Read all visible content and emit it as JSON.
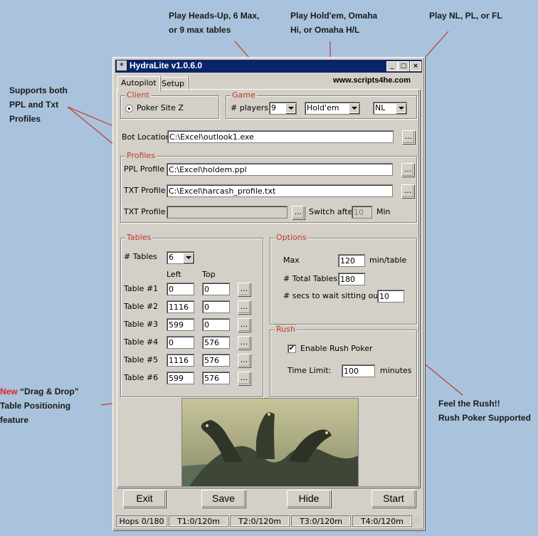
{
  "annotations": {
    "players": [
      "Play Heads-Up, 6 Max,",
      "or 9 max tables"
    ],
    "game": [
      "Play Hold'em, Omaha",
      "Hi, or Omaha H/L"
    ],
    "limit": "Play NL, PL, or FL",
    "profiles": [
      "Supports both",
      "PPL and Txt",
      "Profiles"
    ],
    "drag_new": "New",
    "drag": [
      "“Drag & Drop”",
      "Table Positioning",
      "feature"
    ],
    "rush": [
      "Feel the Rush!!",
      "Rush Poker Supported"
    ]
  },
  "window": {
    "title": "HydraLite v1.0.6.0",
    "controls": [
      "_",
      "□",
      "×"
    ],
    "website": "www.scripts4he.com"
  },
  "tabs": [
    "Autopilot",
    "Setup"
  ],
  "client": {
    "title": "Client",
    "option": "Poker Site Z"
  },
  "game": {
    "title": "Game",
    "players_label": "# players:",
    "players_value": "9",
    "game_value": "Hold'em",
    "limit_value": "NL"
  },
  "bot_location": {
    "label": "Bot Location",
    "value": "C:\\Excel\\outlook1.exe",
    "browse": "..."
  },
  "profiles": {
    "title": "Profiles",
    "ppl_label": "PPL Profile",
    "ppl_value": "C:\\Excel\\holdem.ppl",
    "txt_label": "TXT Profile",
    "txt_value": "C:\\Excel\\harcash_profile.txt",
    "txt2_label": "TXT Profile",
    "txt2_value": "",
    "switch_label": "Switch after",
    "switch_value": "10",
    "switch_unit": "Min",
    "browse": "..."
  },
  "tables": {
    "title": "Tables",
    "count_label": "# Tables",
    "count_value": "6",
    "col_left": "Left",
    "col_top": "Top",
    "rows": [
      {
        "label": "Table #1",
        "left": "0",
        "top": "0"
      },
      {
        "label": "Table #2",
        "left": "1116",
        "top": "0"
      },
      {
        "label": "Table #3",
        "left": "599",
        "top": "0"
      },
      {
        "label": "Table #4",
        "left": "0",
        "top": "576"
      },
      {
        "label": "Table #5",
        "left": "1116",
        "top": "576"
      },
      {
        "label": "Table #6",
        "left": "599",
        "top": "576"
      }
    ],
    "browse": "..."
  },
  "options": {
    "title": "Options",
    "max_label": "Max",
    "max_value": "120",
    "max_unit": "min/table",
    "total_label": "# Total Tables",
    "total_value": "180",
    "wait_label": "# secs to wait sitting out:",
    "wait_value": "10"
  },
  "rush": {
    "title": "Rush",
    "enable_label": "Enable Rush Poker",
    "enable_mark": "✔",
    "limit_label": "Time Limit:",
    "limit_value": "100",
    "limit_unit": "minutes"
  },
  "buttons": {
    "exit": "Exit",
    "save": "Save",
    "hide": "Hide",
    "start": "Start"
  },
  "status": [
    "Hops 0/180",
    "T1:0/120m",
    "T2:0/120m",
    "T3:0/120m",
    "T4:0/120m"
  ]
}
